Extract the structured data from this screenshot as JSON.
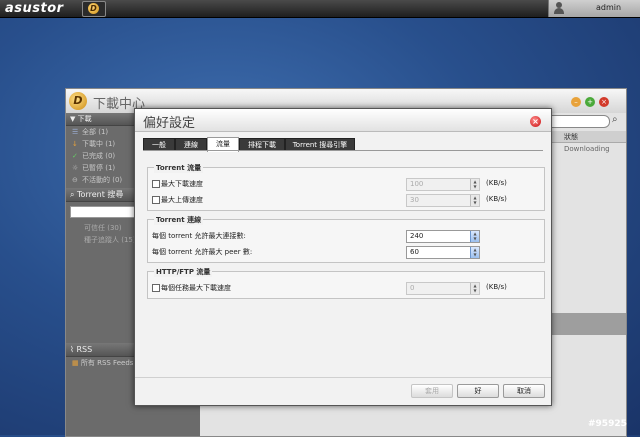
{
  "taskbar": {
    "brand": "asustor",
    "app_icon_letter": "D",
    "user": "admin"
  },
  "app": {
    "title": "下載中心",
    "icon_letter": "D",
    "sidebar": {
      "download_header": "下載",
      "items": [
        {
          "label": "全部 (1)",
          "icon": "list-icon"
        },
        {
          "label": "下載中 (1)",
          "icon": "download-arrow-icon"
        },
        {
          "label": "已完成 (0)",
          "icon": "check-icon"
        },
        {
          "label": "已暫停 (1)",
          "icon": "pause-icon"
        },
        {
          "label": "不活動的 (0)",
          "icon": "inactive-icon"
        }
      ],
      "search_header": "Torrent 搜尋",
      "search_subitems": [
        "可信任 (30)",
        "種子追蹤人 (15)"
      ],
      "rss_header": "RSS",
      "rss_item": "所有 RSS Feeds"
    },
    "list": {
      "status_column": "狀態",
      "status_value": "Downloading"
    }
  },
  "dialog": {
    "title": "偏好設定",
    "tabs": [
      {
        "label": "一般",
        "active": false
      },
      {
        "label": "連線",
        "active": false
      },
      {
        "label": "流量",
        "active": true
      },
      {
        "label": "排程下載",
        "active": false
      },
      {
        "label": "Torrent 搜尋引擎",
        "active": false
      }
    ],
    "torrent_traffic": {
      "title": "Torrent 流量",
      "max_download": {
        "label": "最大下載速度",
        "checked": false,
        "value": "100",
        "unit": "(KB/s)"
      },
      "max_upload": {
        "label": "最大上傳速度",
        "checked": false,
        "value": "30",
        "unit": "(KB/s)"
      }
    },
    "torrent_connection": {
      "title": "Torrent 連線",
      "max_connections": {
        "label": "每個 torrent 允許最大連接數:",
        "value": "240"
      },
      "max_peers": {
        "label": "每個 torrent 允許最大 peer 數:",
        "value": "60"
      }
    },
    "http_ftp": {
      "title": "HTTP/FTP 流量",
      "max_download": {
        "label": "每個任務最大下載速度",
        "checked": false,
        "value": "0",
        "unit": "(KB/s)"
      }
    },
    "buttons": {
      "apply": "套用",
      "ok": "好",
      "cancel": "取消"
    }
  },
  "watermark": "#95925"
}
